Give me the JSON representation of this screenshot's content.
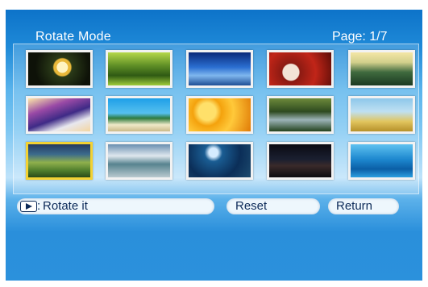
{
  "screen": {
    "title": "Rotate Mode",
    "page_indicator": "Page: 1/7",
    "grid": {
      "columns": 5,
      "rows": 3,
      "selected_index": 10,
      "thumbnails": [
        {
          "icon": "photo-flower-icon"
        },
        {
          "icon": "photo-forest-icon"
        },
        {
          "icon": "photo-blue-sky-icon"
        },
        {
          "icon": "photo-portrait-icon"
        },
        {
          "icon": "photo-hills-icon"
        },
        {
          "icon": "photo-waves-icon"
        },
        {
          "icon": "photo-palm-beach-icon"
        },
        {
          "icon": "photo-orange-flowers-icon"
        },
        {
          "icon": "photo-waterfall-icon"
        },
        {
          "icon": "photo-wheat-field-icon"
        },
        {
          "icon": "photo-meadow-icon"
        },
        {
          "icon": "photo-coast-icon"
        },
        {
          "icon": "photo-city-night-icon"
        },
        {
          "icon": "photo-dark-scene-icon"
        },
        {
          "icon": "photo-ocean-icon"
        }
      ]
    },
    "buttons": {
      "rotate": {
        "icon": "play-icon",
        "label": "Rotate it",
        "separator": ":"
      },
      "reset": {
        "label": "Reset"
      },
      "return": {
        "label": "Return"
      }
    },
    "colors": {
      "text_light": "#ffffff",
      "text_dark": "#0c2a58",
      "selection": "#f3d233",
      "button_bg": "#eef7fd"
    }
  }
}
